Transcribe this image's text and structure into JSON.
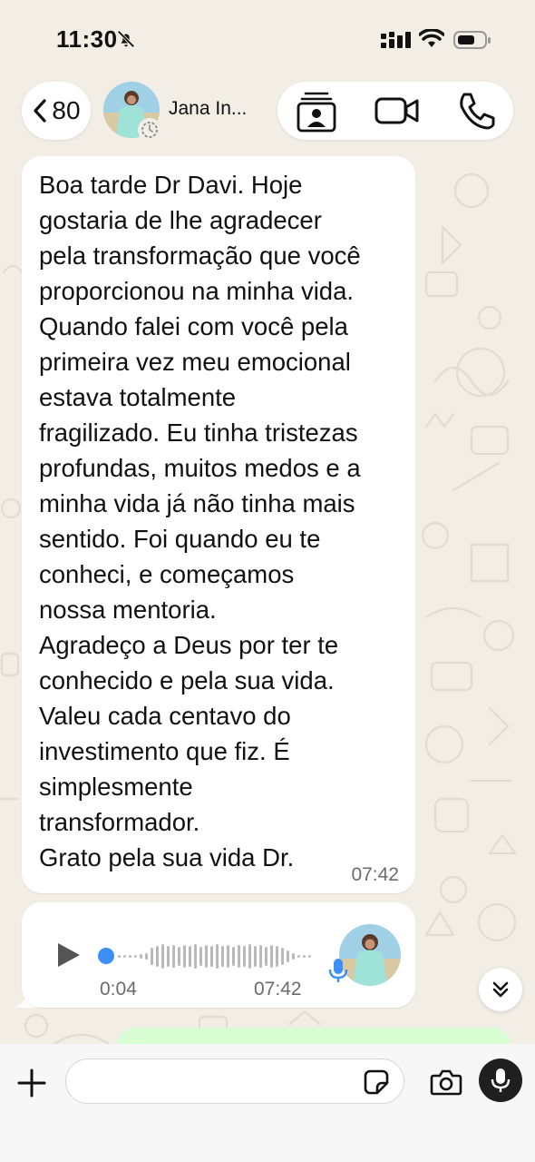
{
  "status_bar": {
    "time": "11:30",
    "icons": [
      "bell-slash-icon",
      "cellular-signal-icon",
      "wifi-icon",
      "battery-icon"
    ]
  },
  "header": {
    "back_count": "80",
    "contact_name": "Jana In...",
    "actions": [
      "contact-card-icon",
      "video-call-icon",
      "voice-call-icon"
    ]
  },
  "message": {
    "text": "Boa tarde Dr Davi. Hoje\ngostaria de lhe agradecer\npela transformação que você\nproporcionou na minha vida.\nQuando falei com você pela\nprimeira vez meu emocional\nestava totalmente\nfragilizado. Eu tinha tristezas\nprofundas, muitos medos e a\nminha vida já não tinha mais\nsentido. Foi quando eu te\nconheci, e começamos\nnossa mentoria.\nAgradeço a Deus por ter te\nconhecido e pela sua vida.\nValeu cada centavo do\ninvestimento que fiz. É\nsimplesmente\ntransformador.\nGrato pela sua vida Dr.",
    "time": "07:42"
  },
  "voice_message": {
    "duration": "0:04",
    "time": "07:42",
    "playback_progress": 0
  },
  "input": {
    "placeholder": "",
    "value": ""
  },
  "colors": {
    "background": "#f2ede5",
    "bubble": "#ffffff",
    "outgoing_bubble": "#d9fdd3",
    "voice_dot": "#3b8ff7",
    "mic_button": "#1f1f1f"
  }
}
